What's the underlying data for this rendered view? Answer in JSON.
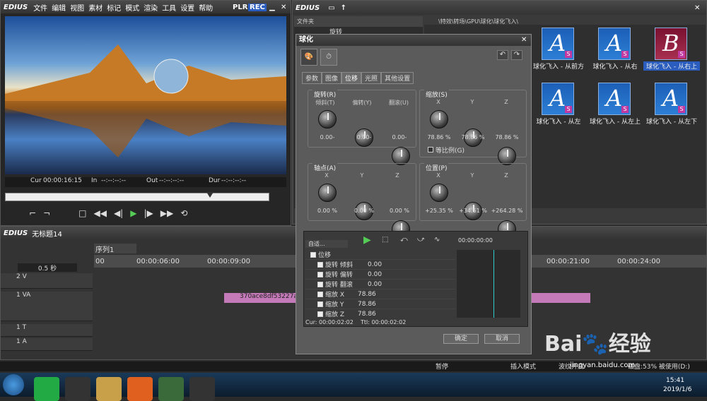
{
  "player": {
    "app": "EDIUS",
    "menu": [
      "文件",
      "编辑",
      "视图",
      "素材",
      "标记",
      "模式",
      "渲染",
      "工具",
      "设置",
      "帮助"
    ],
    "plr": "PLR",
    "rec": "REC",
    "cur_label": "Cur",
    "cur": "00:00:16:15",
    "in_label": "In",
    "in": "--:--:--:--",
    "out_label": "Out",
    "out": "--:--:--:--",
    "dur_label": "Dur",
    "dur": "--:--:--:--"
  },
  "bin": {
    "app": "EDIUS",
    "folder_header": "文件夹",
    "folder_item": "旋转",
    "path": "\\特效\\转场\\GPU\\球化\\球化飞入\\"
  },
  "thumbs": [
    {
      "letter": "A",
      "label": "球化飞入 - 从前方",
      "selected": false
    },
    {
      "letter": "A",
      "label": "球化飞入 - 从右",
      "selected": false
    },
    {
      "letter": "B",
      "label": "球化飞入 - 从右上",
      "selected": true
    },
    {
      "letter": "A",
      "label": "球化飞入 - 从左",
      "selected": false
    },
    {
      "letter": "A",
      "label": "球化飞入 - 从左上",
      "selected": false
    },
    {
      "letter": "A",
      "label": "球化飞入 - 从左下",
      "selected": false
    }
  ],
  "dialog": {
    "title": "球化",
    "tabs": [
      "参数",
      "图像",
      "位移",
      "光照",
      "其他设置"
    ],
    "rotate": {
      "title": "旋转(R)",
      "labels": [
        "倾斜(T)",
        "偏转(Y)",
        "翻滚(U)"
      ],
      "values": [
        "0.00-",
        "0.00-",
        "0.00-"
      ]
    },
    "scale": {
      "title": "缩放(S)",
      "labels": [
        "X",
        "Y",
        "Z"
      ],
      "values": [
        "78.86 %",
        "78.86 %",
        "78.86 %"
      ],
      "lock": "等比例(G)"
    },
    "pivot": {
      "title": "轴点(A)",
      "labels": [
        "X",
        "Y",
        "Z"
      ],
      "values": [
        "0.00 %",
        "0.00 %",
        "0.00 %"
      ]
    },
    "position": {
      "title": "位置(P)",
      "labels": [
        "X",
        "Y",
        "Z"
      ],
      "values": [
        "+25.35 %",
        "+34.61 %",
        "+264.28 %"
      ]
    },
    "auto": "自适...",
    "kf_time": "00:00:00:00",
    "rows": [
      {
        "name": "位移",
        "value": ""
      },
      {
        "name": "旋转 倾斜",
        "value": "0.00"
      },
      {
        "name": "旋转 偏转",
        "value": "0.00"
      },
      {
        "name": "旋转 翻滚",
        "value": "0.00"
      },
      {
        "name": "缩放 X",
        "value": "78.86"
      },
      {
        "name": "缩放 Y",
        "value": "78.86"
      },
      {
        "name": "缩放 Z",
        "value": "78.86"
      }
    ],
    "cur": "Cur: 00:00:02:02",
    "ttl": "Ttl: 00:00:02:02",
    "ok": "确定",
    "cancel": "取消"
  },
  "timeline": {
    "app": "EDIUS",
    "project": "无标题14",
    "seq": "序列1",
    "zoom": "0.5 秒",
    "ruler": [
      "00:00:06:00",
      "00:00:09:00",
      "00:00:21:00",
      "00:00:24:00"
    ],
    "ruler_left": "00",
    "tracks": [
      {
        "name": "2 V",
        "icon": "▤"
      },
      {
        "name": "1 VA",
        "icon": "▤"
      },
      {
        "name": "1 T",
        "icon": "T"
      },
      {
        "name": "1 A",
        "icon": "◀)"
      }
    ],
    "clip": "370ace8df53227a2"
  },
  "status": {
    "pause": "暂停",
    "insert": "插入模式",
    "ripple": "波纹开启",
    "disk": "磁盘:53% 被使用(D:)"
  },
  "taskbar": {
    "time": "15:41",
    "date": "2019/1/6"
  },
  "watermark": {
    "brand": "Bai",
    "brand2": "经验",
    "url": "jingyan.baidu.com"
  }
}
